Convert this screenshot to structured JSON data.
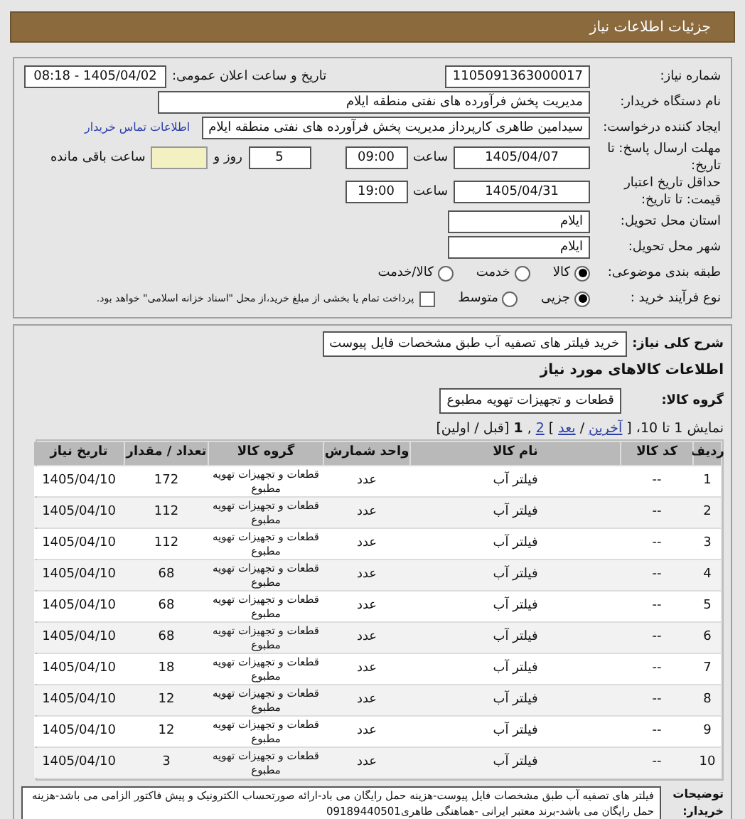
{
  "header": {
    "title": "جزئیات اطلاعات نیاز"
  },
  "details": {
    "need_number": {
      "label": "شماره نیاز:",
      "value": "1105091363000017"
    },
    "announce": {
      "label": "تاریخ و ساعت اعلان عمومی:",
      "value": "1405/04/02 - 08:18"
    },
    "buyer": {
      "label": "نام دستگاه خریدار:",
      "value": "مدیریت پخش فرآورده های نفتی منطقه ایلام"
    },
    "creator": {
      "label": "ایجاد کننده درخواست:",
      "value": "سیدامین طاهری کارپرداز مدیریت پخش فرآورده های نفتی منطقه ایلام",
      "link": "اطلاعات تماس خریدار"
    },
    "deadline": {
      "label": "مهلت ارسال پاسخ: تا تاریخ:",
      "date": "1405/04/07",
      "time_label": "ساعت",
      "time": "09:00",
      "days": "5",
      "days_label": "روز و",
      "remaining_label": "ساعت باقی مانده"
    },
    "validity": {
      "label": "حداقل تاریخ اعتبار قیمت: تا تاریخ:",
      "date": "1405/04/31",
      "time_label": "ساعت",
      "time": "19:00"
    },
    "province": {
      "label": "استان محل تحویل:",
      "value": "ایلام"
    },
    "city": {
      "label": "شهر محل تحویل:",
      "value": "ایلام"
    },
    "category": {
      "label": "طبقه بندی موضوعی:",
      "options": [
        {
          "label": "کالا",
          "selected": true
        },
        {
          "label": "خدمت",
          "selected": false
        },
        {
          "label": "کالا/خدمت",
          "selected": false
        }
      ]
    },
    "process": {
      "label": "نوع فرآیند خرید :",
      "options": [
        {
          "label": "جزیی",
          "selected": true
        },
        {
          "label": "متوسط",
          "selected": false
        }
      ],
      "treasury": {
        "label": "پرداخت تمام یا بخشی از مبلغ خرید،از محل \"اسناد خزانه اسلامی\" خواهد بود.",
        "checked": false
      }
    }
  },
  "summary": {
    "label": "شرح کلی نیاز:",
    "value": "خرید فیلتر های تصفیه آب طبق مشخصات فایل پیوست"
  },
  "goods_heading": "اطلاعات کالاهای مورد نیاز",
  "group": {
    "label": "گروه کالا:",
    "value": "قطعات و تجهیزات تهویه مطبوع"
  },
  "pagination": [
    {
      "kind": "text",
      "text": "نمایش 1 تا 10، ["
    },
    {
      "kind": "link",
      "text": "آخرین"
    },
    {
      "kind": "text",
      "text": "/"
    },
    {
      "kind": "link",
      "text": "بعد"
    },
    {
      "kind": "text",
      "text": "]"
    },
    {
      "kind": "link",
      "text": "2"
    },
    {
      "kind": "text",
      "text": ","
    },
    {
      "kind": "current",
      "text": "1"
    },
    {
      "kind": "text",
      "text": "[قبل / اولین]"
    }
  ],
  "table": {
    "columns": [
      "ردیف",
      "کد کالا",
      "نام کالا",
      "واحد شمارش",
      "گروه کالا",
      "تعداد / مقدار",
      "تاریخ نیاز"
    ],
    "rows": [
      [
        "1",
        "--",
        "فیلتر آب",
        "عدد",
        "قطعات و تجهیزات تهویه مطبوع",
        "172",
        "1405/04/10"
      ],
      [
        "2",
        "--",
        "فیلتر آب",
        "عدد",
        "قطعات و تجهیزات تهویه مطبوع",
        "112",
        "1405/04/10"
      ],
      [
        "3",
        "--",
        "فیلتر آب",
        "عدد",
        "قطعات و تجهیزات تهویه مطبوع",
        "112",
        "1405/04/10"
      ],
      [
        "4",
        "--",
        "فیلتر آب",
        "عدد",
        "قطعات و تجهیزات تهویه مطبوع",
        "68",
        "1405/04/10"
      ],
      [
        "5",
        "--",
        "فیلتر آب",
        "عدد",
        "قطعات و تجهیزات تهویه مطبوع",
        "68",
        "1405/04/10"
      ],
      [
        "6",
        "--",
        "فیلتر آب",
        "عدد",
        "قطعات و تجهیزات تهویه مطبوع",
        "68",
        "1405/04/10"
      ],
      [
        "7",
        "--",
        "فیلتر آب",
        "عدد",
        "قطعات و تجهیزات تهویه مطبوع",
        "18",
        "1405/04/10"
      ],
      [
        "8",
        "--",
        "فیلتر آب",
        "عدد",
        "قطعات و تجهیزات تهویه مطبوع",
        "12",
        "1405/04/10"
      ],
      [
        "9",
        "--",
        "فیلتر آب",
        "عدد",
        "قطعات و تجهیزات تهویه مطبوع",
        "12",
        "1405/04/10"
      ],
      [
        "10",
        "--",
        "فیلتر آب",
        "عدد",
        "قطعات و تجهیزات تهویه مطبوع",
        "3",
        "1405/04/10"
      ]
    ]
  },
  "notes": {
    "label": "توضیحات خریدار:",
    "value": "فیلتر های تصفیه آب طبق مشخصات فایل پیوست-هزینه حمل رایگان می باد-ارائه صورتحساب الکترونیک و پیش فاکتور الزامی می باشد-هزینه حمل رایگان می باشد-برند معتبر ایرانی -هماهنگی طاهری09189440501"
  }
}
